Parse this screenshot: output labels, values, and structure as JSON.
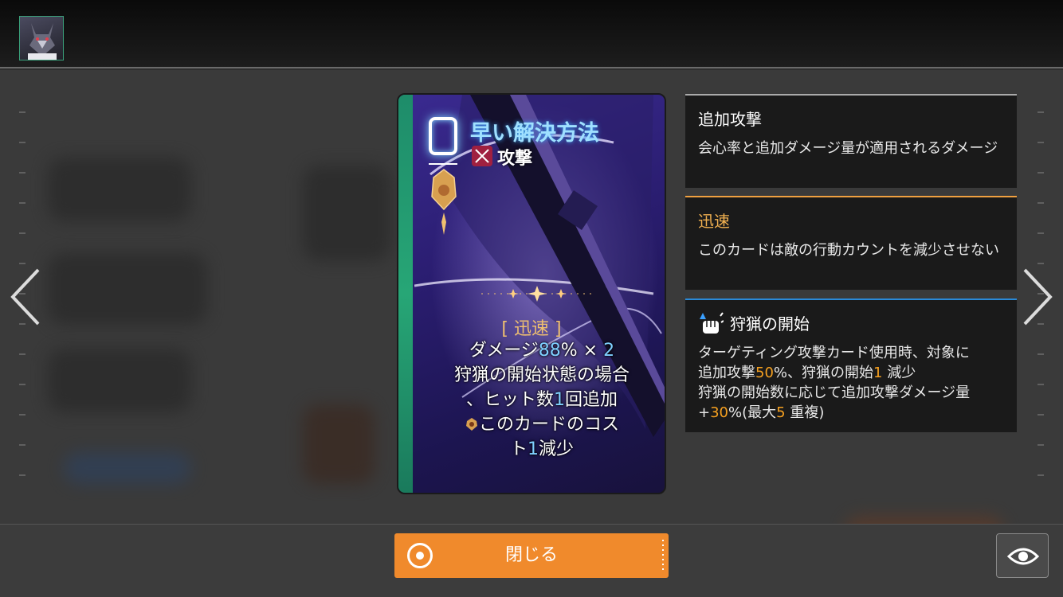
{
  "card": {
    "cost": "0",
    "title": "早い解決方法",
    "type": "攻撃",
    "keyword": "[ 迅速 ]",
    "desc": {
      "line1_pre": "ダメージ",
      "line1_val": "88",
      "line1_post": "% × ",
      "line1_mult": "2",
      "line2": "狩猟の開始状態の場合",
      "line3_pre": "、ヒット数",
      "line3_val": "1",
      "line3_post": "回追加",
      "line4": "このカードのコス",
      "line5_pre": "ト",
      "line5_val": "1",
      "line5_post": "減少"
    }
  },
  "panels": {
    "extra_attack": {
      "title": "追加攻撃",
      "body": "会心率と追加ダメージ量が適用されるダメージ"
    },
    "swift": {
      "title": "迅速",
      "body": "このカードは敵の行動カウントを減少させない"
    },
    "hunt_start": {
      "title": "狩猟の開始",
      "l1": "ターゲティング攻撃カード使用時、対象に",
      "l2_pre": "追加攻撃",
      "l2_val": "50",
      "l2_mid": "%、狩猟の開始",
      "l2_val2": "1",
      "l2_post": " 減少",
      "l3": "狩猟の開始数に応じて追加攻撃ダメージ量",
      "l4_pre": "+",
      "l4_val": "30",
      "l4_mid": "%(最大",
      "l4_val2": "5",
      "l4_post": " 重複)"
    }
  },
  "buttons": {
    "close_label": "閉じる"
  },
  "icons": {
    "avatar": "wolf-avatar-icon",
    "prev": "chevron-left-icon",
    "next": "chevron-right-icon",
    "close": "target-circle-icon",
    "view": "eye-icon",
    "type": "crossed-swords-icon",
    "hunt": "fist-icon"
  },
  "colors": {
    "accent_orange": "#f08a2c",
    "highlight_blue": "#7fd0ff",
    "highlight_orange": "#f5a020",
    "card_title": "#9fe0ff"
  }
}
